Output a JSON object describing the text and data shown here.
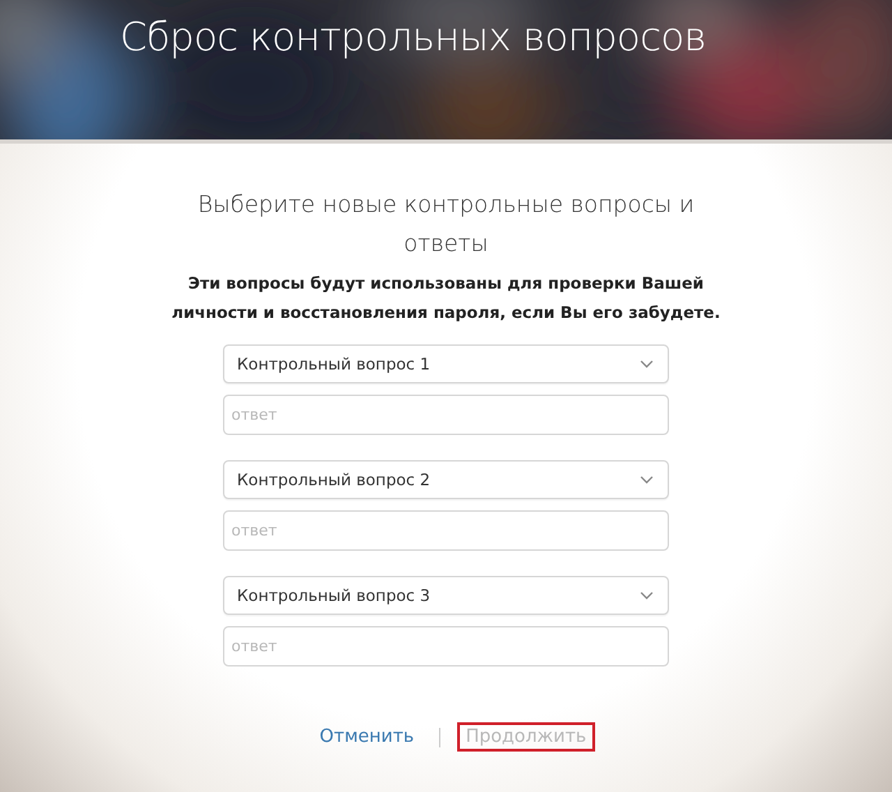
{
  "header": {
    "title": "Сброс контрольных вопросов"
  },
  "form": {
    "heading": "Выберите новые контрольные вопросы и ответы",
    "description": "Эти вопросы будут использованы для проверки Вашей личности и восстановления пароля, если Вы его забудете.",
    "questions": [
      {
        "select": "Контрольный вопрос 1",
        "answer_placeholder": "ответ"
      },
      {
        "select": "Контрольный вопрос 2",
        "answer_placeholder": "ответ"
      },
      {
        "select": "Контрольный вопрос 3",
        "answer_placeholder": "ответ"
      }
    ]
  },
  "actions": [
    {
      "label": "Отменить",
      "disabled": false,
      "highlighted": false
    },
    {
      "label": "Продолжить",
      "disabled": true,
      "highlighted": true
    }
  ]
}
